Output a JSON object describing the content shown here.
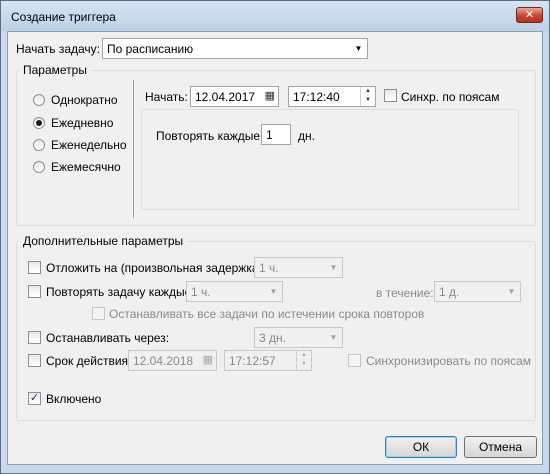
{
  "window": {
    "title": "Создание триггера",
    "close_label": "✕"
  },
  "trigger": {
    "label": "Начать задачу:",
    "value": "По расписанию"
  },
  "parameters": {
    "title": "Параметры",
    "radios": [
      {
        "label": "Однократно",
        "selected": false
      },
      {
        "label": "Ежедневно",
        "selected": true
      },
      {
        "label": "Еженедельно",
        "selected": false
      },
      {
        "label": "Ежемесячно",
        "selected": false
      }
    ],
    "start_label": "Начать:",
    "start_date": "12.04.2017",
    "start_time": "17:12:40",
    "sync_label": "Синхр. по поясам",
    "repeat_every_label": "Повторять каждые:",
    "repeat_every_value": "1",
    "repeat_every_unit": "дн."
  },
  "advanced": {
    "title": "Дополнительные параметры",
    "delay": {
      "label": "Отложить на (произвольная задержка):",
      "value": "1 ч.",
      "checked": false
    },
    "repeat": {
      "label": "Повторять задачу каждые:",
      "value": "1 ч.",
      "duration_label": "в течение:",
      "duration_value": "1 д.",
      "checked": false
    },
    "stop_all": {
      "label": "Останавливать все задачи по истечении срока повторов",
      "checked": false
    },
    "stop_after": {
      "label": "Останавливать через:",
      "value": "3 дн.",
      "checked": false
    },
    "expire": {
      "label": "Срок действия:",
      "date": "12.04.2018",
      "time": "17:12:57",
      "sync_label": "Синхронизировать по поясам",
      "checked": false
    },
    "enabled": {
      "label": "Включено",
      "checked": true,
      "mark": "✓"
    }
  },
  "buttons": {
    "ok": "ОК",
    "cancel": "Отмена"
  },
  "icons": {
    "dropdown": "▼",
    "calendar": "▦",
    "spin_up": "▲",
    "spin_down": "▼"
  }
}
